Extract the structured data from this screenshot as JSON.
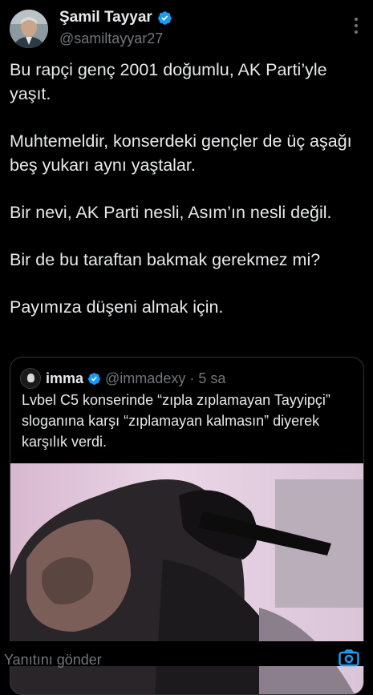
{
  "tweet": {
    "author": {
      "name": "Şamil Tayyar",
      "handle": "@samiltayyar27",
      "verified": true
    },
    "paragraphs": [
      "Bu rapçi genç 2001 doğumlu, AK Parti’yle yaşıt.",
      "Muhtemeldir, konserdeki gençler de üç aşağı beş yukarı aynı yaştalar.",
      "Bir nevi, AK Parti nesli, Asım’ın nesli değil.",
      "Bir de bu taraftan bakmak gerekmez mi?",
      "Payımıza düşeni almak için."
    ]
  },
  "quote": {
    "author_name": "imma",
    "handle_time": "@immadexy · 5 sa",
    "verified": true,
    "text": "Lvbel C5 konserinde “zıpla zıplamayan Tayyipçi” sloganına karşı “zıplamayan kalmasın” diyerek karşılık verdi.",
    "media": "video-thumbnail"
  },
  "reply_bar": {
    "placeholder": "Yanıtını gönder",
    "icon": "camera-icon"
  },
  "colors": {
    "background": "#000000",
    "text": "#e7e9ea",
    "secondary": "#71767b",
    "accent": "#1d9bf0",
    "border": "#2f3336"
  }
}
